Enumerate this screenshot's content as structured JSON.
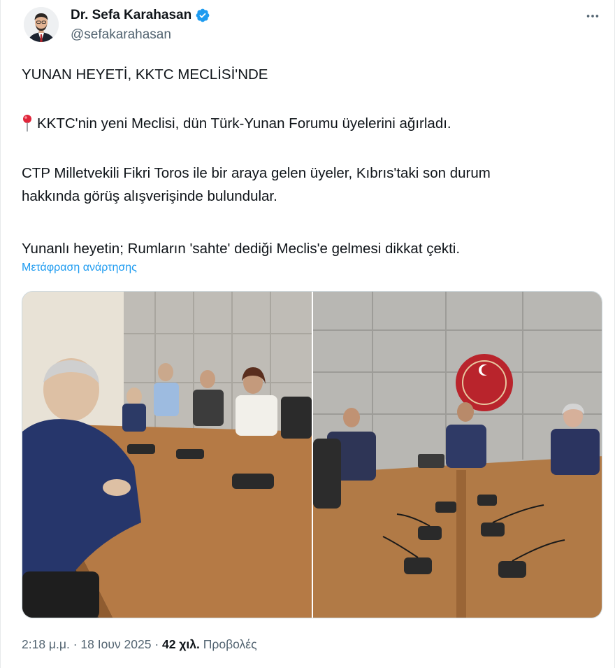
{
  "author": {
    "display_name": "Dr. Sefa Karahasan",
    "handle": "@sefakarahasan"
  },
  "tweet": {
    "lines": [
      "YUNAN HEYETİ, KKTC MECLİSİ'NDE",
      "KKTC'nin yeni Meclisi, dün Türk-Yunan Forumu üyelerini ağırladı.",
      "CTP Milletvekili Fikri Toros ile bir araya gelen üyeler, Kıbrıs'taki son durum",
      "hakkında görüş alışverişinde bulundular.",
      "Yunanlı heyetin; Rumların 'sahte' dediği Meclis'e gelmesi dikkat çekti."
    ],
    "translate_label": "Μετάφραση ανάρτησης"
  },
  "icons": {
    "verified": "verified-badge-icon",
    "more": "more-options-icon",
    "pin": "round-pushpin-emoji"
  },
  "meta": {
    "time": "2:18 μ.μ.",
    "separator": "·",
    "date": "18 Ιουν 2025",
    "views_count": "42 χιλ.",
    "views_label": "Προβολές"
  },
  "colors": {
    "accent": "#1d9bf0",
    "text": "#0f1419",
    "secondary": "#536471"
  }
}
